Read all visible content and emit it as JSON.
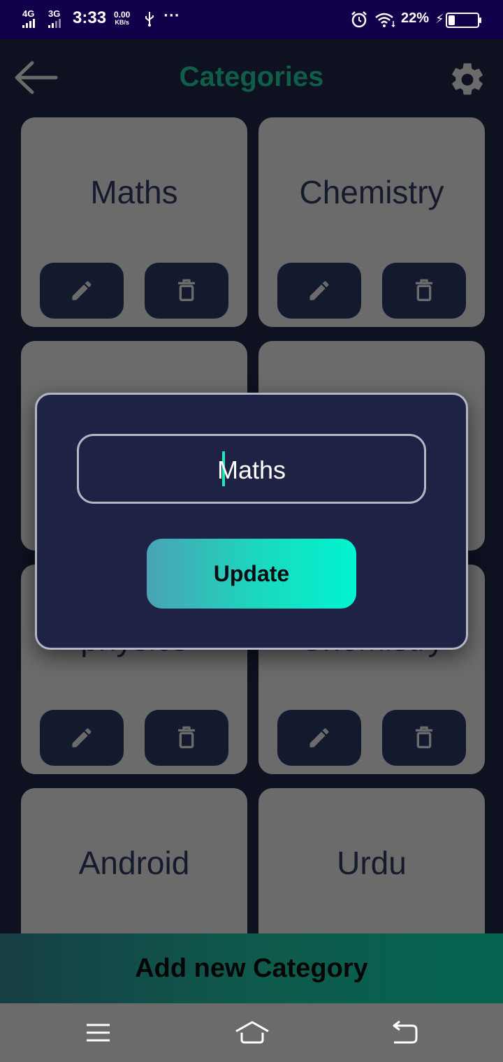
{
  "status_bar": {
    "network_1": "4G",
    "network_2": "3G",
    "time": "3:33",
    "speed_value": "0.00",
    "speed_unit": "KB/s",
    "more": "···",
    "battery_percent": "22%",
    "battery_level": 0.22
  },
  "header": {
    "title": "Categories",
    "back_icon": "arrow-left-icon",
    "settings_icon": "gear-icon"
  },
  "categories": [
    {
      "name": "Maths"
    },
    {
      "name": "Chemistry"
    },
    {
      "name": ""
    },
    {
      "name": ""
    },
    {
      "name": "physics"
    },
    {
      "name": "Chemistry"
    },
    {
      "name": "Android"
    },
    {
      "name": "Urdu"
    }
  ],
  "card_actions": {
    "edit_icon": "pencil-icon",
    "delete_icon": "trash-icon"
  },
  "dialog": {
    "input_value": "Maths",
    "update_label": "Update"
  },
  "add_category_label": "Add new Category",
  "nav_bar": {
    "menu_icon": "menu-icon",
    "home_icon": "home-icon",
    "back_icon": "return-icon"
  },
  "colors": {
    "title": "#0f5e48",
    "card": "#6b6b6b",
    "dialog": "#1e2244",
    "accent": "#00f5d0",
    "status_bar": "#12004a"
  }
}
